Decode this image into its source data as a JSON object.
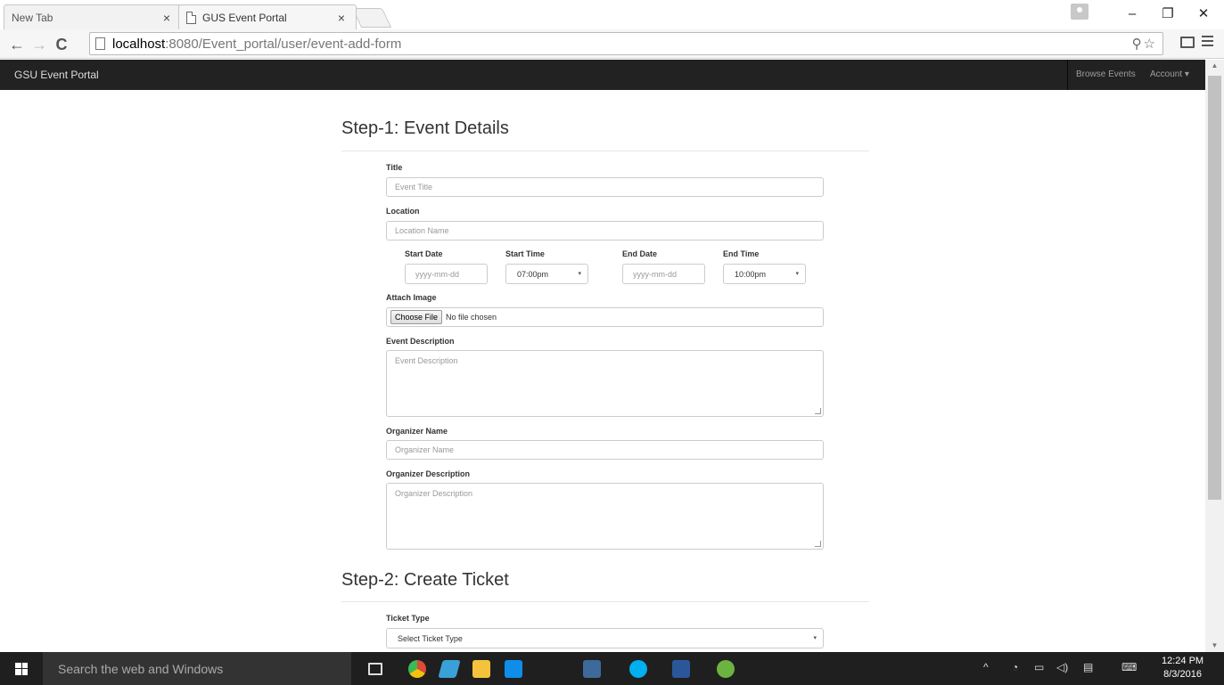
{
  "browser": {
    "tabs": [
      {
        "title": "New Tab",
        "active": false
      },
      {
        "title": "GUS Event Portal",
        "active": true
      }
    ],
    "tab_close_glyph": "×",
    "url_host": "localhost",
    "url_path": ":8080/Event_portal/user/event-add-form",
    "controls": {
      "minimize": "–",
      "restore": "❐",
      "close": "✕"
    }
  },
  "navbar": {
    "brand": "GSU Event Portal",
    "links": {
      "browse": "Browse Events",
      "account": "Account"
    },
    "account_caret": "▾"
  },
  "step1": {
    "heading": "Step-1: Event Details",
    "title_label": "Title",
    "title_placeholder": "Event Title",
    "location_label": "Location",
    "location_placeholder": "Location Name",
    "start_date_label": "Start Date",
    "start_date_placeholder": "yyyy-mm-dd",
    "start_time_label": "Start Time",
    "start_time_value": "07:00pm",
    "end_date_label": "End Date",
    "end_date_placeholder": "yyyy-mm-dd",
    "end_time_label": "End Time",
    "end_time_value": "10:00pm",
    "image_label": "Attach Image",
    "file_button": "Choose File",
    "file_status": "No file chosen",
    "description_label": "Event Description",
    "description_placeholder": "Event Description",
    "organizer_label": "Organizer Name",
    "organizer_placeholder": "Organizer Name",
    "organizer_desc_label": "Organizer Description",
    "organizer_desc_placeholder": "Organizer Description"
  },
  "step2": {
    "heading": "Step-2: Create Ticket",
    "ticket_type_label": "Ticket Type",
    "ticket_type_value": "Select Ticket Type"
  },
  "taskbar": {
    "search_placeholder": "Search the web and Windows",
    "time": "12:24 PM",
    "date": "8/3/2016",
    "app_icons": [
      "task-view-icon",
      "chrome-icon",
      "explorer-icon",
      "file-manager-icon",
      "teamviewer-icon",
      "sql-workbench-icon",
      "skype-icon",
      "word-icon",
      "spring-tool-icon"
    ],
    "colors": {
      "chrome": "#dd4b39",
      "skype": "#00aff0",
      "word": "#2b579a",
      "spring": "#6db33f",
      "teamviewer": "#0e8ee9",
      "folder": "#f5c33b"
    }
  }
}
